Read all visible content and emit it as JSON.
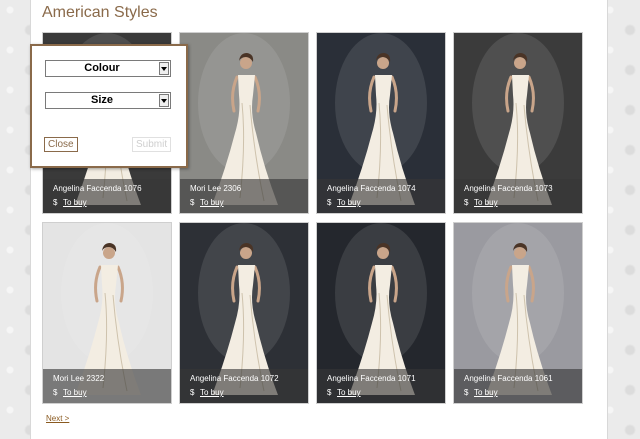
{
  "page": {
    "title": "American Styles"
  },
  "products": [
    {
      "name": "Angelina Faccenda 1076",
      "price_symbol": "$",
      "buy_label": "To buy",
      "bg": "#3a3a3a"
    },
    {
      "name": "Mori Lee 2306",
      "price_symbol": "$",
      "buy_label": "To buy",
      "bg": "#8a8a86"
    },
    {
      "name": "Angelina Faccenda 1074",
      "price_symbol": "$",
      "buy_label": "To buy",
      "bg": "#2a2f38"
    },
    {
      "name": "Angelina Faccenda 1073",
      "price_symbol": "$",
      "buy_label": "To buy",
      "bg": "#3b3b3b"
    },
    {
      "name": "Mori Lee 2322",
      "price_symbol": "$",
      "buy_label": "To buy",
      "bg": "#e4e4e4"
    },
    {
      "name": "Angelina Faccenda 1072",
      "price_symbol": "$",
      "buy_label": "To buy",
      "bg": "#2d3036"
    },
    {
      "name": "Angelina Faccenda 1071",
      "price_symbol": "$",
      "buy_label": "To buy",
      "bg": "#24272d"
    },
    {
      "name": "Angelina Faccenda 1061",
      "price_symbol": "$",
      "buy_label": "To buy",
      "bg": "#9a9aa0"
    }
  ],
  "pagination": {
    "next_label": "Next >"
  },
  "filter": {
    "colour_label": "Colour",
    "size_label": "Size",
    "close_label": "Close",
    "submit_label": "Submit"
  }
}
